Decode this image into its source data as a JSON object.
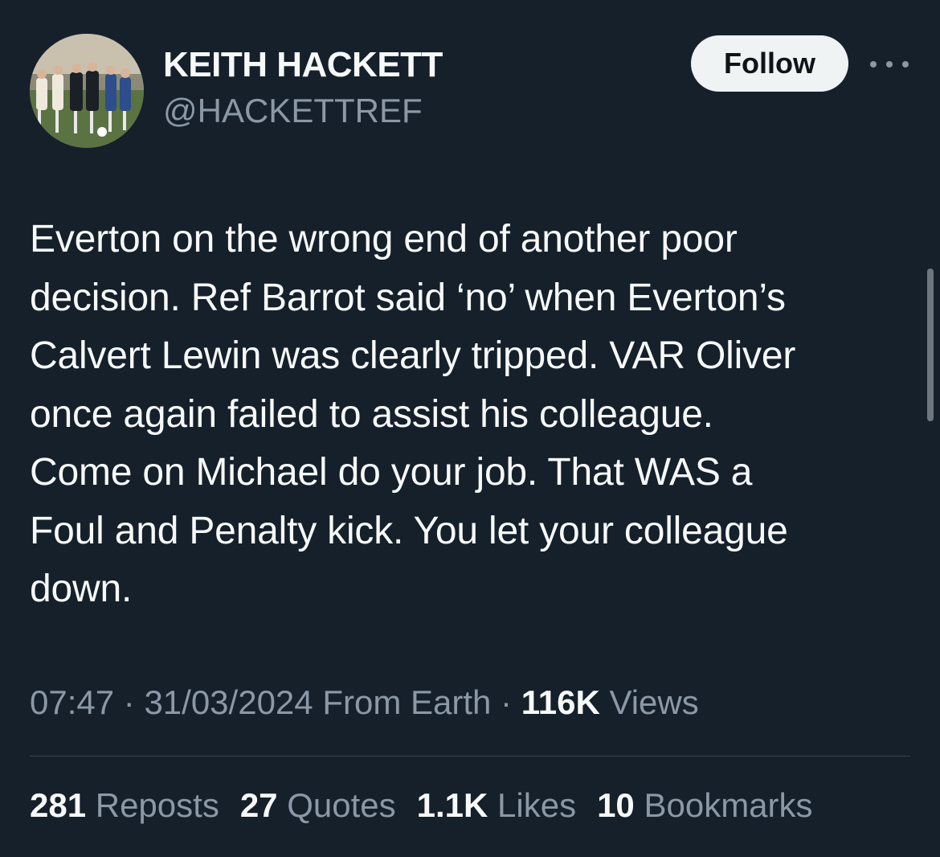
{
  "author": {
    "display_name": "KEITH HACKETT",
    "handle": "@HACKETTREF",
    "avatar_icon": "referee-photo-avatar"
  },
  "actions": {
    "follow_label": "Follow",
    "more_icon": "more-horizontal-icon"
  },
  "tweet": {
    "text": "Everton on the wrong end of another poor\ndecision. Ref Barrot said ‘no’ when Everton’s\nCalvert Lewin was clearly tripped. VAR Oliver\nonce again failed to assist his colleague.\nCome on Michael do your job. That WAS a\nFoul and Penalty kick. You let your colleague\ndown."
  },
  "meta": {
    "time": "07:47",
    "separator": " · ",
    "date": "31/03/2024",
    "source": " From Earth",
    "views_count": "116K",
    "views_label": " Views"
  },
  "stats": [
    {
      "count": "281",
      "label": " Reposts"
    },
    {
      "count": "27",
      "label": " Quotes"
    },
    {
      "count": "1.1K",
      "label": " Likes"
    },
    {
      "count": "10",
      "label": " Bookmarks"
    }
  ],
  "colors": {
    "background": "#15202b",
    "primary_text": "#f7f9f9",
    "secondary_text": "#8b98a5",
    "button_bg": "#eff3f4",
    "button_text": "#0f1419",
    "divider": "#38444d"
  }
}
